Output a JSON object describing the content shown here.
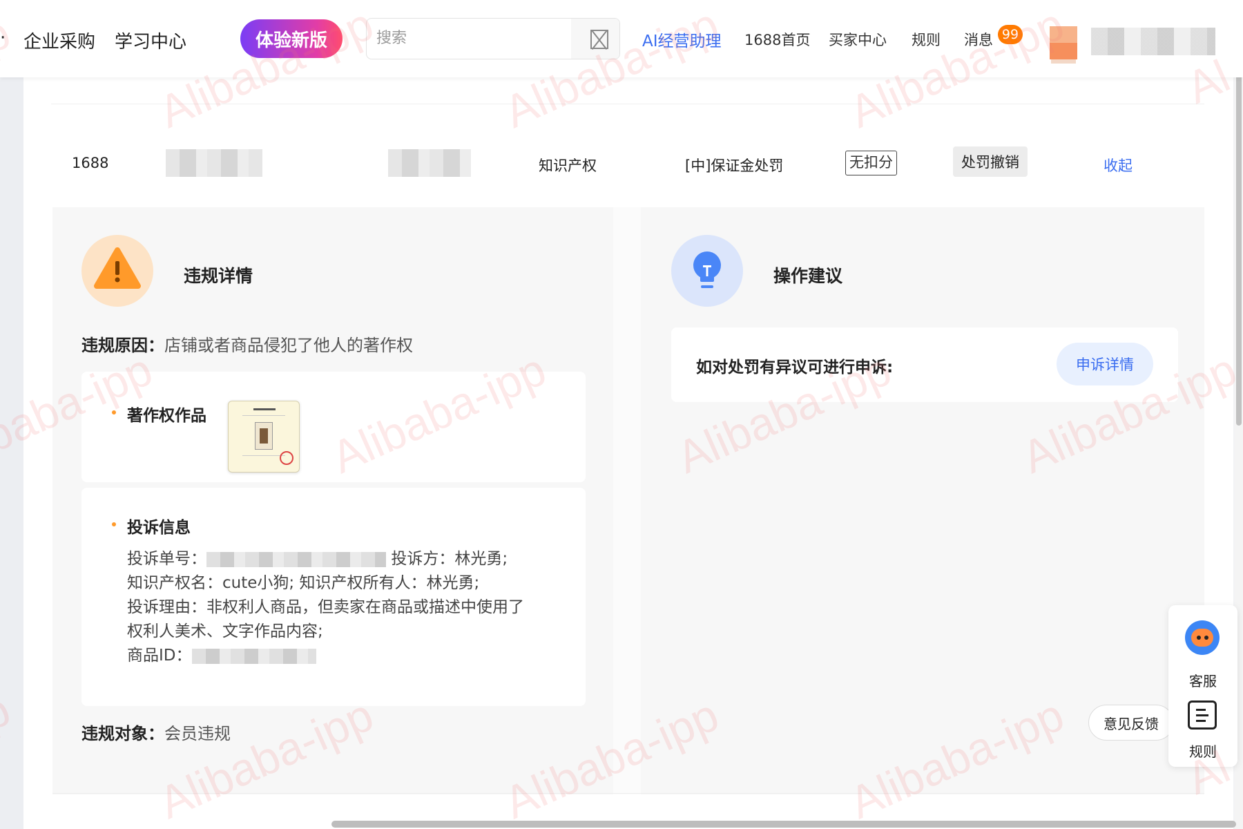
{
  "header": {
    "nav_links": [
      "企业采购",
      "学习中心"
    ],
    "new_version_label": "体验新版",
    "search_placeholder": "搜索",
    "ai_link": "AI经营助理",
    "links": [
      "1688首页",
      "买家中心",
      "规则",
      "消息"
    ],
    "message_badge": "99"
  },
  "record": {
    "platform": "1688",
    "category": "知识产权",
    "penalty_type": "[中]保证金处罚",
    "score_tag": "无扣分",
    "status": "处罚撤销",
    "collapse_label": "收起"
  },
  "violation": {
    "title": "违规详情",
    "reason_label": "违规原因：",
    "reason_value": "店铺或者商品侵犯了他人的著作权",
    "work_heading": "著作权作品",
    "complaint_heading": "投诉信息",
    "complaint_no_label": "投诉单号：",
    "complainant_label": "投诉方：",
    "complainant_value": "林光勇;",
    "ip_name_label": "知识产权名：",
    "ip_name_value": "cute小狗;",
    "ip_owner_label": "知识产权所有人：",
    "ip_owner_value": "林光勇;",
    "reason2_label": "投诉理由：",
    "reason2_line1": "非权利人商品，但卖家在商品或描述中使用了",
    "reason2_line2": "权利人美术、文字作品内容;",
    "product_id_label": "商品ID：",
    "object_label": "违规对象：",
    "object_value": "会员违规"
  },
  "suggestion": {
    "title": "操作建议",
    "appeal_text": "如对处罚有异议可进行申诉:",
    "appeal_button": "申诉详情"
  },
  "float_widgets": {
    "feedback_label": "意见反馈",
    "customer_service_label": "客服",
    "rules_label": "规则"
  },
  "watermark_text": "Alibaba-ipp",
  "colors": {
    "accent_blue": "#3a6df0",
    "badge_orange": "#ff7a00",
    "warning_orange": "#ff9a2a"
  }
}
